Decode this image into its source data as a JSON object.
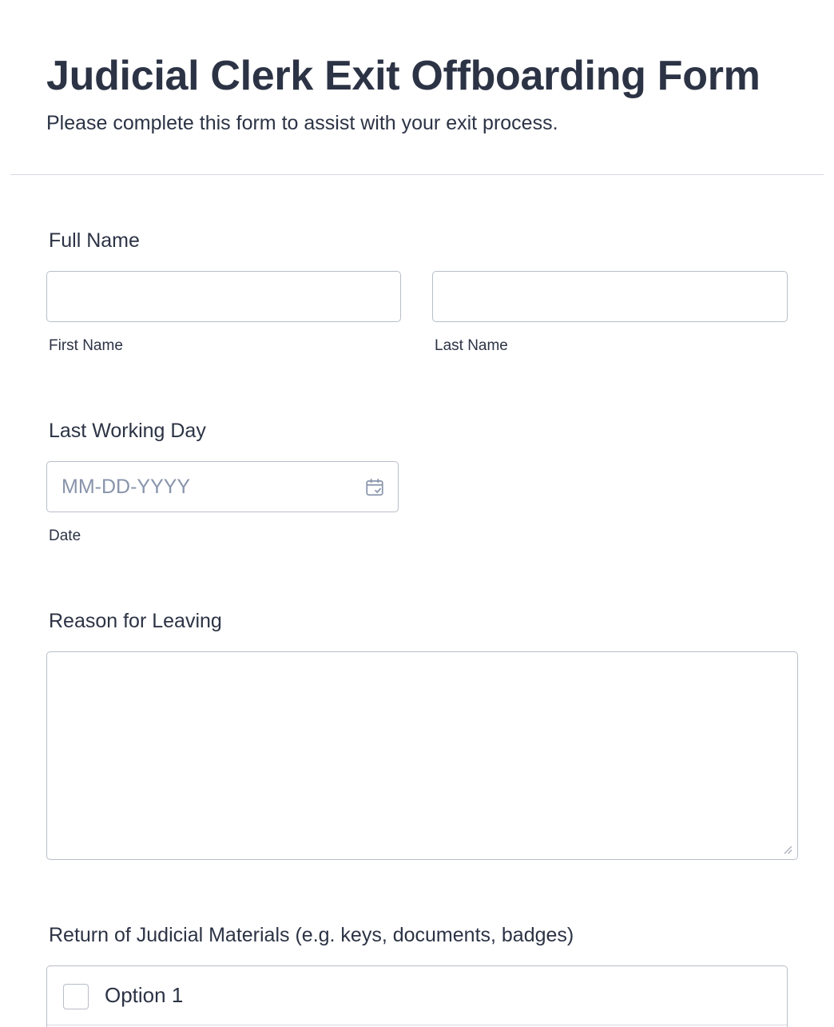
{
  "header": {
    "title": "Judicial Clerk Exit Offboarding Form",
    "subtitle": "Please complete this form to assist with your exit process."
  },
  "full_name": {
    "label": "Full Name",
    "first_sublabel": "First Name",
    "last_sublabel": "Last Name",
    "first_value": "",
    "last_value": ""
  },
  "last_working_day": {
    "label": "Last Working Day",
    "placeholder": "MM-DD-YYYY",
    "sublabel": "Date"
  },
  "reason": {
    "label": "Reason for Leaving",
    "value": ""
  },
  "materials": {
    "label": "Return of Judicial Materials (e.g. keys, documents, badges)",
    "options": [
      "Option 1"
    ]
  },
  "colors": {
    "text": "#2c3345",
    "border": "#b8bdc9",
    "placeholder": "#8894ab",
    "divider": "#d8dae3"
  },
  "icons": {
    "date": "calendar-icon",
    "resize": "resize-handle-icon"
  }
}
